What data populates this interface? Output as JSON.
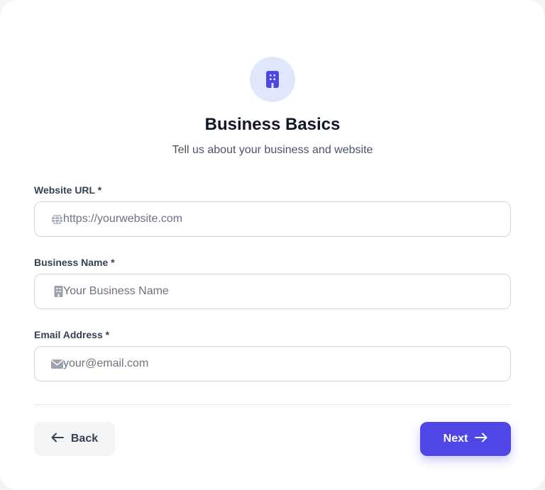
{
  "header": {
    "icon": "building-icon",
    "title": "Business Basics",
    "subtitle": "Tell us about your business and website"
  },
  "form": {
    "website": {
      "label": "Website URL *",
      "placeholder": "https://yourwebsite.com",
      "value": "",
      "icon": "globe-icon"
    },
    "business_name": {
      "label": "Business Name *",
      "placeholder": "Your Business Name",
      "value": "",
      "icon": "building-icon"
    },
    "email": {
      "label": "Email Address *",
      "placeholder": "your@email.com",
      "value": "",
      "icon": "envelope-icon"
    }
  },
  "footer": {
    "back_label": "Back",
    "next_label": "Next"
  },
  "colors": {
    "accent": "#4f46e5",
    "accent_light": "#e0e7ff",
    "text": "#111827",
    "muted": "#6b7280"
  }
}
